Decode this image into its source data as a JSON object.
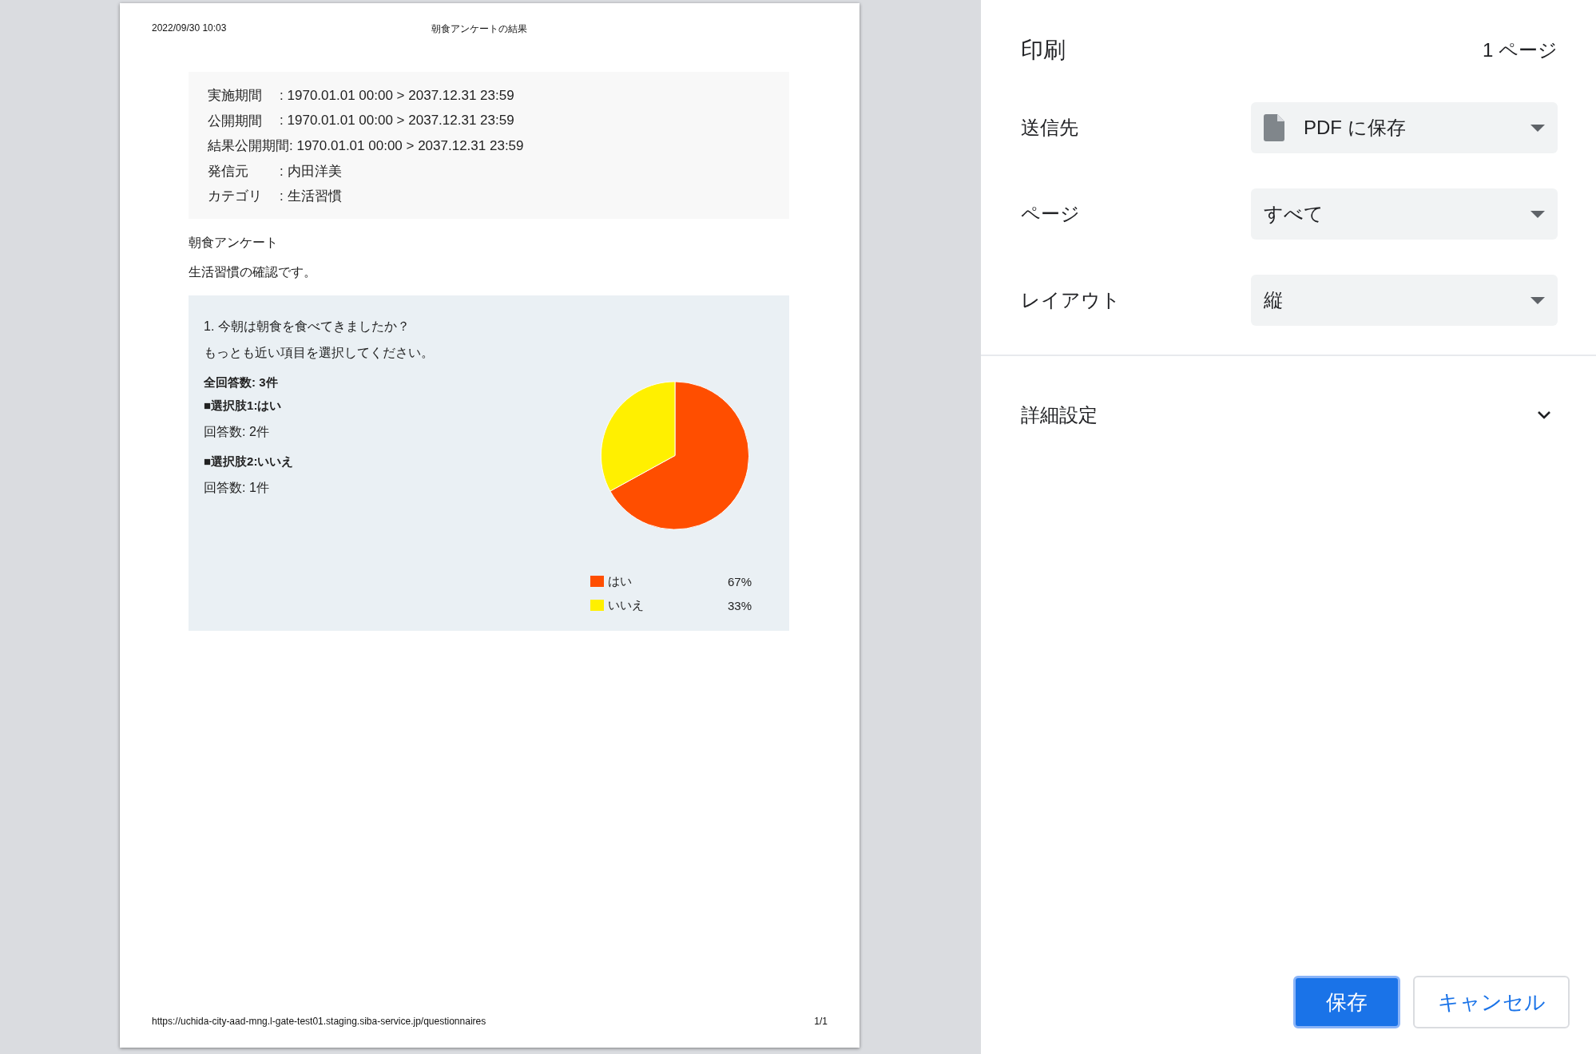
{
  "preview": {
    "header": {
      "date": "2022/09/30 10:03",
      "title": "朝食アンケートの結果"
    },
    "info": [
      {
        "label": "実施期間",
        "value": ": 1970.01.01 00:00 > 2037.12.31 23:59"
      },
      {
        "label": "公開期間",
        "value": ": 1970.01.01 00:00 > 2037.12.31 23:59"
      },
      {
        "label": "結果公開期間",
        "value": ": 1970.01.01 00:00 > 2037.12.31 23:59"
      },
      {
        "label": "発信元",
        "value": ": 内田洋美"
      },
      {
        "label": "カテゴリ",
        "value": ": 生活習慣"
      }
    ],
    "survey_title": "朝食アンケート",
    "description": "生活習慣の確認です。",
    "question": {
      "lines": [
        {
          "kind": "text",
          "text": "1. 今朝は朝食を食べてきましたか？"
        },
        {
          "kind": "text",
          "text": "もっとも近い項目を選択してください。"
        },
        {
          "kind": "bold",
          "text": "全回答数: 3件"
        },
        {
          "kind": "bold",
          "text": "■選択肢1:はい"
        },
        {
          "kind": "text",
          "text": "回答数: 2件"
        },
        {
          "kind": "bold",
          "text": "■選択肢2:いいえ"
        },
        {
          "kind": "text",
          "text": "回答数: 1件"
        }
      ],
      "chart_data": {
        "type": "pie",
        "categories": [
          "はい",
          "いいえ"
        ],
        "values": [
          67,
          33
        ]
      },
      "legend": [
        {
          "percent": "67%",
          "color": "#ff4e00"
        },
        {
          "percent": "33%",
          "color": "#fff000"
        }
      ]
    },
    "footer": {
      "url": "https://uchida-city-aad-mng.l-gate-test01.staging.siba-service.jp/questionnaires",
      "page": "1/1"
    }
  },
  "print_panel": {
    "title": "印刷",
    "page_count": "1 ページ",
    "settings": [
      {
        "label": "送信先",
        "value": "PDF に保存",
        "kind": "with-icon"
      },
      {
        "label": "ページ",
        "value": "すべて",
        "kind": "plain"
      },
      {
        "label": "レイアウト",
        "value": "縦",
        "kind": "plain"
      }
    ],
    "advanced": {
      "label": "詳細設定",
      "expanded": false
    },
    "buttons": [
      {
        "label": "保存",
        "kind": "primary"
      },
      {
        "label": "キャンセル",
        "kind": "secondary"
      }
    ]
  }
}
